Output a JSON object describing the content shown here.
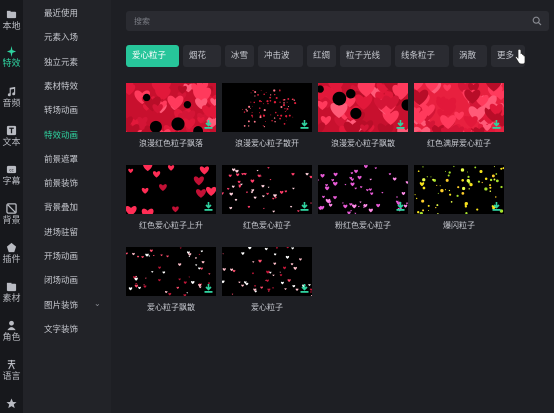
{
  "rail": {
    "items": [
      {
        "label": "本地",
        "icon": "folder-icon"
      },
      {
        "label": "特效",
        "icon": "sparkle-icon",
        "active": true
      },
      {
        "label": "音频",
        "icon": "music-note-icon"
      },
      {
        "label": "文本",
        "icon": "text-icon"
      },
      {
        "label": "字幕",
        "icon": "subtitle-icon"
      },
      {
        "label": "背景",
        "icon": "background-icon"
      },
      {
        "label": "插件",
        "icon": "plugin-icon"
      },
      {
        "label": "素材",
        "icon": "material-folder-icon"
      },
      {
        "label": "角色",
        "icon": "person-icon"
      },
      {
        "label": "语言",
        "icon": "language-icon"
      },
      {
        "label": "",
        "icon": "star-icon"
      }
    ]
  },
  "categories": {
    "items": [
      {
        "label": "最近使用"
      },
      {
        "label": "元素入场"
      },
      {
        "label": "独立元素"
      },
      {
        "label": "素材特效"
      },
      {
        "label": "转场动画"
      },
      {
        "label": "特效动画",
        "active": true
      },
      {
        "label": "前景遮罩"
      },
      {
        "label": "前景装饰"
      },
      {
        "label": "背景叠加"
      },
      {
        "label": "进场驻留"
      },
      {
        "label": "开场动画"
      },
      {
        "label": "闭场动画"
      },
      {
        "label": "图片装饰",
        "has_chevron": true
      },
      {
        "label": "文字装饰"
      }
    ]
  },
  "search": {
    "placeholder": "搜索"
  },
  "tabs": [
    {
      "label": "爱心粒子",
      "active": true
    },
    {
      "label": "烟花"
    },
    {
      "label": "冰雪"
    },
    {
      "label": "冲击波"
    },
    {
      "label": "红绸"
    },
    {
      "label": "粒子光线"
    },
    {
      "label": "线条粒子"
    },
    {
      "label": "涡散"
    },
    {
      "label": "更多"
    }
  ],
  "effects": [
    {
      "label": "浪漫红色粒子飘落",
      "style": "red-dense"
    },
    {
      "label": "浪漫爱心粒子散开",
      "style": "red-sparse"
    },
    {
      "label": "浪漫爱心粒子飘散",
      "style": "red-dense-2"
    },
    {
      "label": "红色满屏爱心粒子",
      "style": "red-full"
    },
    {
      "label": "红色爱心粒子上升",
      "style": "red-rising"
    },
    {
      "label": "红色爱心粒子",
      "style": "pink-dots"
    },
    {
      "label": "粉红色爱心粒子",
      "style": "pink-hearts"
    },
    {
      "label": "爆闪粒子",
      "style": "gold-burst"
    },
    {
      "label": "爱心粒子飘散",
      "style": "white-scatter"
    },
    {
      "label": "爱心粒子",
      "style": "white-red"
    }
  ],
  "colors": {
    "accent": "#27c59a",
    "download": "#2fd3a0"
  }
}
